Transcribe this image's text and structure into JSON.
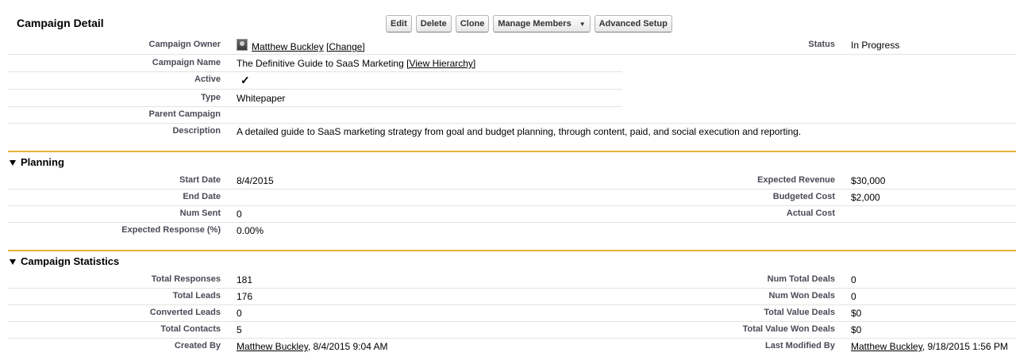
{
  "detail": {
    "title": "Campaign Detail",
    "buttons": {
      "edit": "Edit",
      "delete": "Delete",
      "clone": "Clone",
      "manage_members": "Manage Members",
      "advanced_setup": "Advanced Setup"
    },
    "owner_label": "Campaign Owner",
    "owner_name": "Matthew Buckley",
    "owner_change": "[Change]",
    "status_label": "Status",
    "status_value": "In Progress",
    "name_label": "Campaign Name",
    "name_value": "The Definitive Guide to SaaS Marketing",
    "view_hierarchy": "[View Hierarchy]",
    "active_label": "Active",
    "active_value": "✓",
    "type_label": "Type",
    "type_value": "Whitepaper",
    "parent_label": "Parent Campaign",
    "parent_value": "",
    "description_label": "Description",
    "description_value": "A detailed guide to SaaS marketing strategy from goal and budget planning, through content, paid, and social execution and reporting."
  },
  "planning": {
    "heading": "Planning",
    "start_date_label": "Start Date",
    "start_date_value": "8/4/2015",
    "end_date_label": "End Date",
    "end_date_value": "",
    "num_sent_label": "Num Sent",
    "num_sent_value": "0",
    "expected_response_label": "Expected Response (%)",
    "expected_response_value": "0.00%",
    "expected_revenue_label": "Expected Revenue",
    "expected_revenue_value": "$30,000",
    "budgeted_cost_label": "Budgeted Cost",
    "budgeted_cost_value": "$2,000",
    "actual_cost_label": "Actual Cost",
    "actual_cost_value": ""
  },
  "stats": {
    "heading": "Campaign Statistics",
    "total_responses_label": "Total Responses",
    "total_responses_value": "181",
    "total_leads_label": "Total Leads",
    "total_leads_value": "176",
    "converted_leads_label": "Converted Leads",
    "converted_leads_value": "0",
    "total_contacts_label": "Total Contacts",
    "total_contacts_value": "5",
    "created_by_label": "Created By",
    "created_by_name": "Matthew Buckley",
    "created_by_date": ", 8/4/2015 9:04 AM",
    "num_total_deals_label": "Num Total Deals",
    "num_total_deals_value": "0",
    "num_won_deals_label": "Num Won Deals",
    "num_won_deals_value": "0",
    "total_value_deals_label": "Total Value Deals",
    "total_value_deals_value": "$0",
    "total_value_won_deals_label": "Total Value Won Deals",
    "total_value_won_deals_value": "$0",
    "last_modified_label": "Last Modified By",
    "last_modified_name": "Matthew Buckley",
    "last_modified_date": ", 9/18/2015 1:56 PM"
  }
}
